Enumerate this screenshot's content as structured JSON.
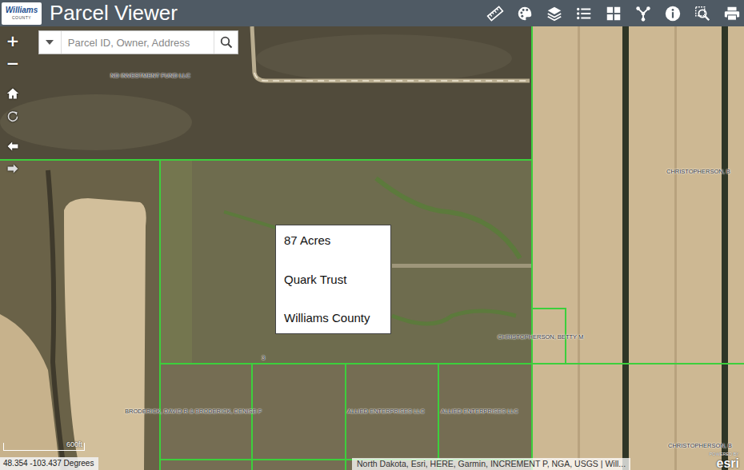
{
  "header": {
    "logo": {
      "name": "Williams",
      "sub": "COUNTY"
    },
    "title": "Parcel Viewer"
  },
  "search": {
    "placeholder": "Parcel ID, Owner, Address"
  },
  "zoom": {
    "in": "+",
    "out": "−"
  },
  "map": {
    "parcel_labels": [
      {
        "text": "ND INVESTMENT FUND LLC"
      },
      {
        "text": "CHRISTOPHERSON, B"
      },
      {
        "text": "CHRISTOPHERSON, BETTY M"
      },
      {
        "text": "BRODERICK, DAVID R & BRODERICK, DENISE F"
      },
      {
        "text": "ALLIED ENTERPRISES LLC"
      },
      {
        "text": "ALLIED ENTERPRISES LLC"
      },
      {
        "text": "CHRISTOPHERSON, B"
      }
    ],
    "lot_number": "3"
  },
  "info_box": {
    "lines": [
      "87 Acres",
      "Quark Trust",
      "Williams County"
    ]
  },
  "scale_bar": {
    "label": "600ft"
  },
  "coordinates": "48.354 -103.437 Degrees",
  "attribution": "North Dakota, Esri, HERE, Garmin, INCREMENT P, NGA, USGS | Will...",
  "esri": {
    "powered_by": "POWERED BY",
    "logo": "esri"
  }
}
